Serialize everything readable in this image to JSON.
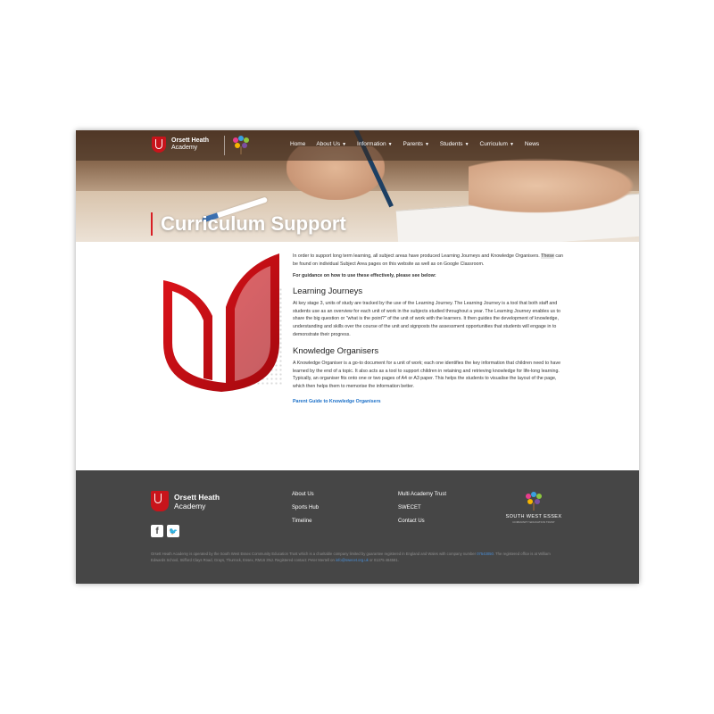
{
  "header": {
    "logo_line1": "Orsett Heath",
    "logo_line2": "Academy",
    "nav": [
      {
        "label": "Home",
        "dropdown": false
      },
      {
        "label": "About Us",
        "dropdown": true
      },
      {
        "label": "Information",
        "dropdown": true
      },
      {
        "label": "Parents",
        "dropdown": true
      },
      {
        "label": "Students",
        "dropdown": true
      },
      {
        "label": "Curriculum",
        "dropdown": true
      },
      {
        "label": "News",
        "dropdown": false
      }
    ]
  },
  "hero": {
    "title": "Curriculum Support"
  },
  "main": {
    "intro_before": "In order to support long term learning, all subject areas have produced Learning Journeys and Knowledge Organisers. ",
    "intro_highlight": "These",
    "intro_after": " can be found on individual Subject Area pages on this website as well as on Google Classroom.",
    "guidance": "For guidance on how to use these effectively, please see below:",
    "section1_title": "Learning Journeys",
    "section1_text": "At key stage 3, units of study are tracked by the use of the Learning Journey. The Learning Journey is a tool that both staff and students use as an overview for each unit of work in the subjects studied throughout a year. The Learning Journey enables us to share the big question or \"what is the point?\" of the unit of work with the learners. It then guides the development of knowledge, understanding and skills over the course of the unit and signposts the assessment opportunities that students will engage in to demonstrate their progress.",
    "section2_title": "Knowledge Organisers",
    "section2_text": "A Knowledge Organiser is a go-to document for a unit of work; each one identifies the key information that children need to have learned by the end of a topic. It also acts as a tool to support children in retaining and retrieving knowledge for life-long learning. Typically, an organiser fits onto one or two pages of A4 or A3 paper. This helps the students to visualise the layout of the page, which then helps them to memorise the information better.",
    "link_label": "Parent Guide to Knowledge Organisers"
  },
  "footer": {
    "logo_line1": "Orsett Heath",
    "logo_line2": "Academy",
    "col1": [
      "About Us",
      "Sports Hub",
      "Timeline"
    ],
    "col2": [
      "Multi Academy Trust",
      "SWECET",
      "Contact Us"
    ],
    "swe_name": "SOUTH WEST ESSEX",
    "swe_sub": "COMMUNITY EDUCATION TRUST",
    "legal_1": "Orsett Heath Academy is operated by the South West Essex Community Education Trust which is a charitable company limited by guarantee registered in England and Wales with company number ",
    "legal_company_no": "07543050",
    "legal_2": ". The registered office is at William Edwards School, Stifford Clays Road, Grays, Thurrock, Essex, RM16 3NJ. Registered contact: Peter Mertell on ",
    "legal_email": "info@swecet.org.uk",
    "legal_3": " or 01375 484581."
  },
  "colors": {
    "brand_red": "#c8141b",
    "footer_bg": "#464646",
    "link_blue": "#1a6fc8"
  },
  "icons": {
    "logo": "academy-shield-logo-icon",
    "tree": "swe-tree-icon",
    "facebook": "facebook-icon",
    "twitter": "twitter-icon"
  }
}
